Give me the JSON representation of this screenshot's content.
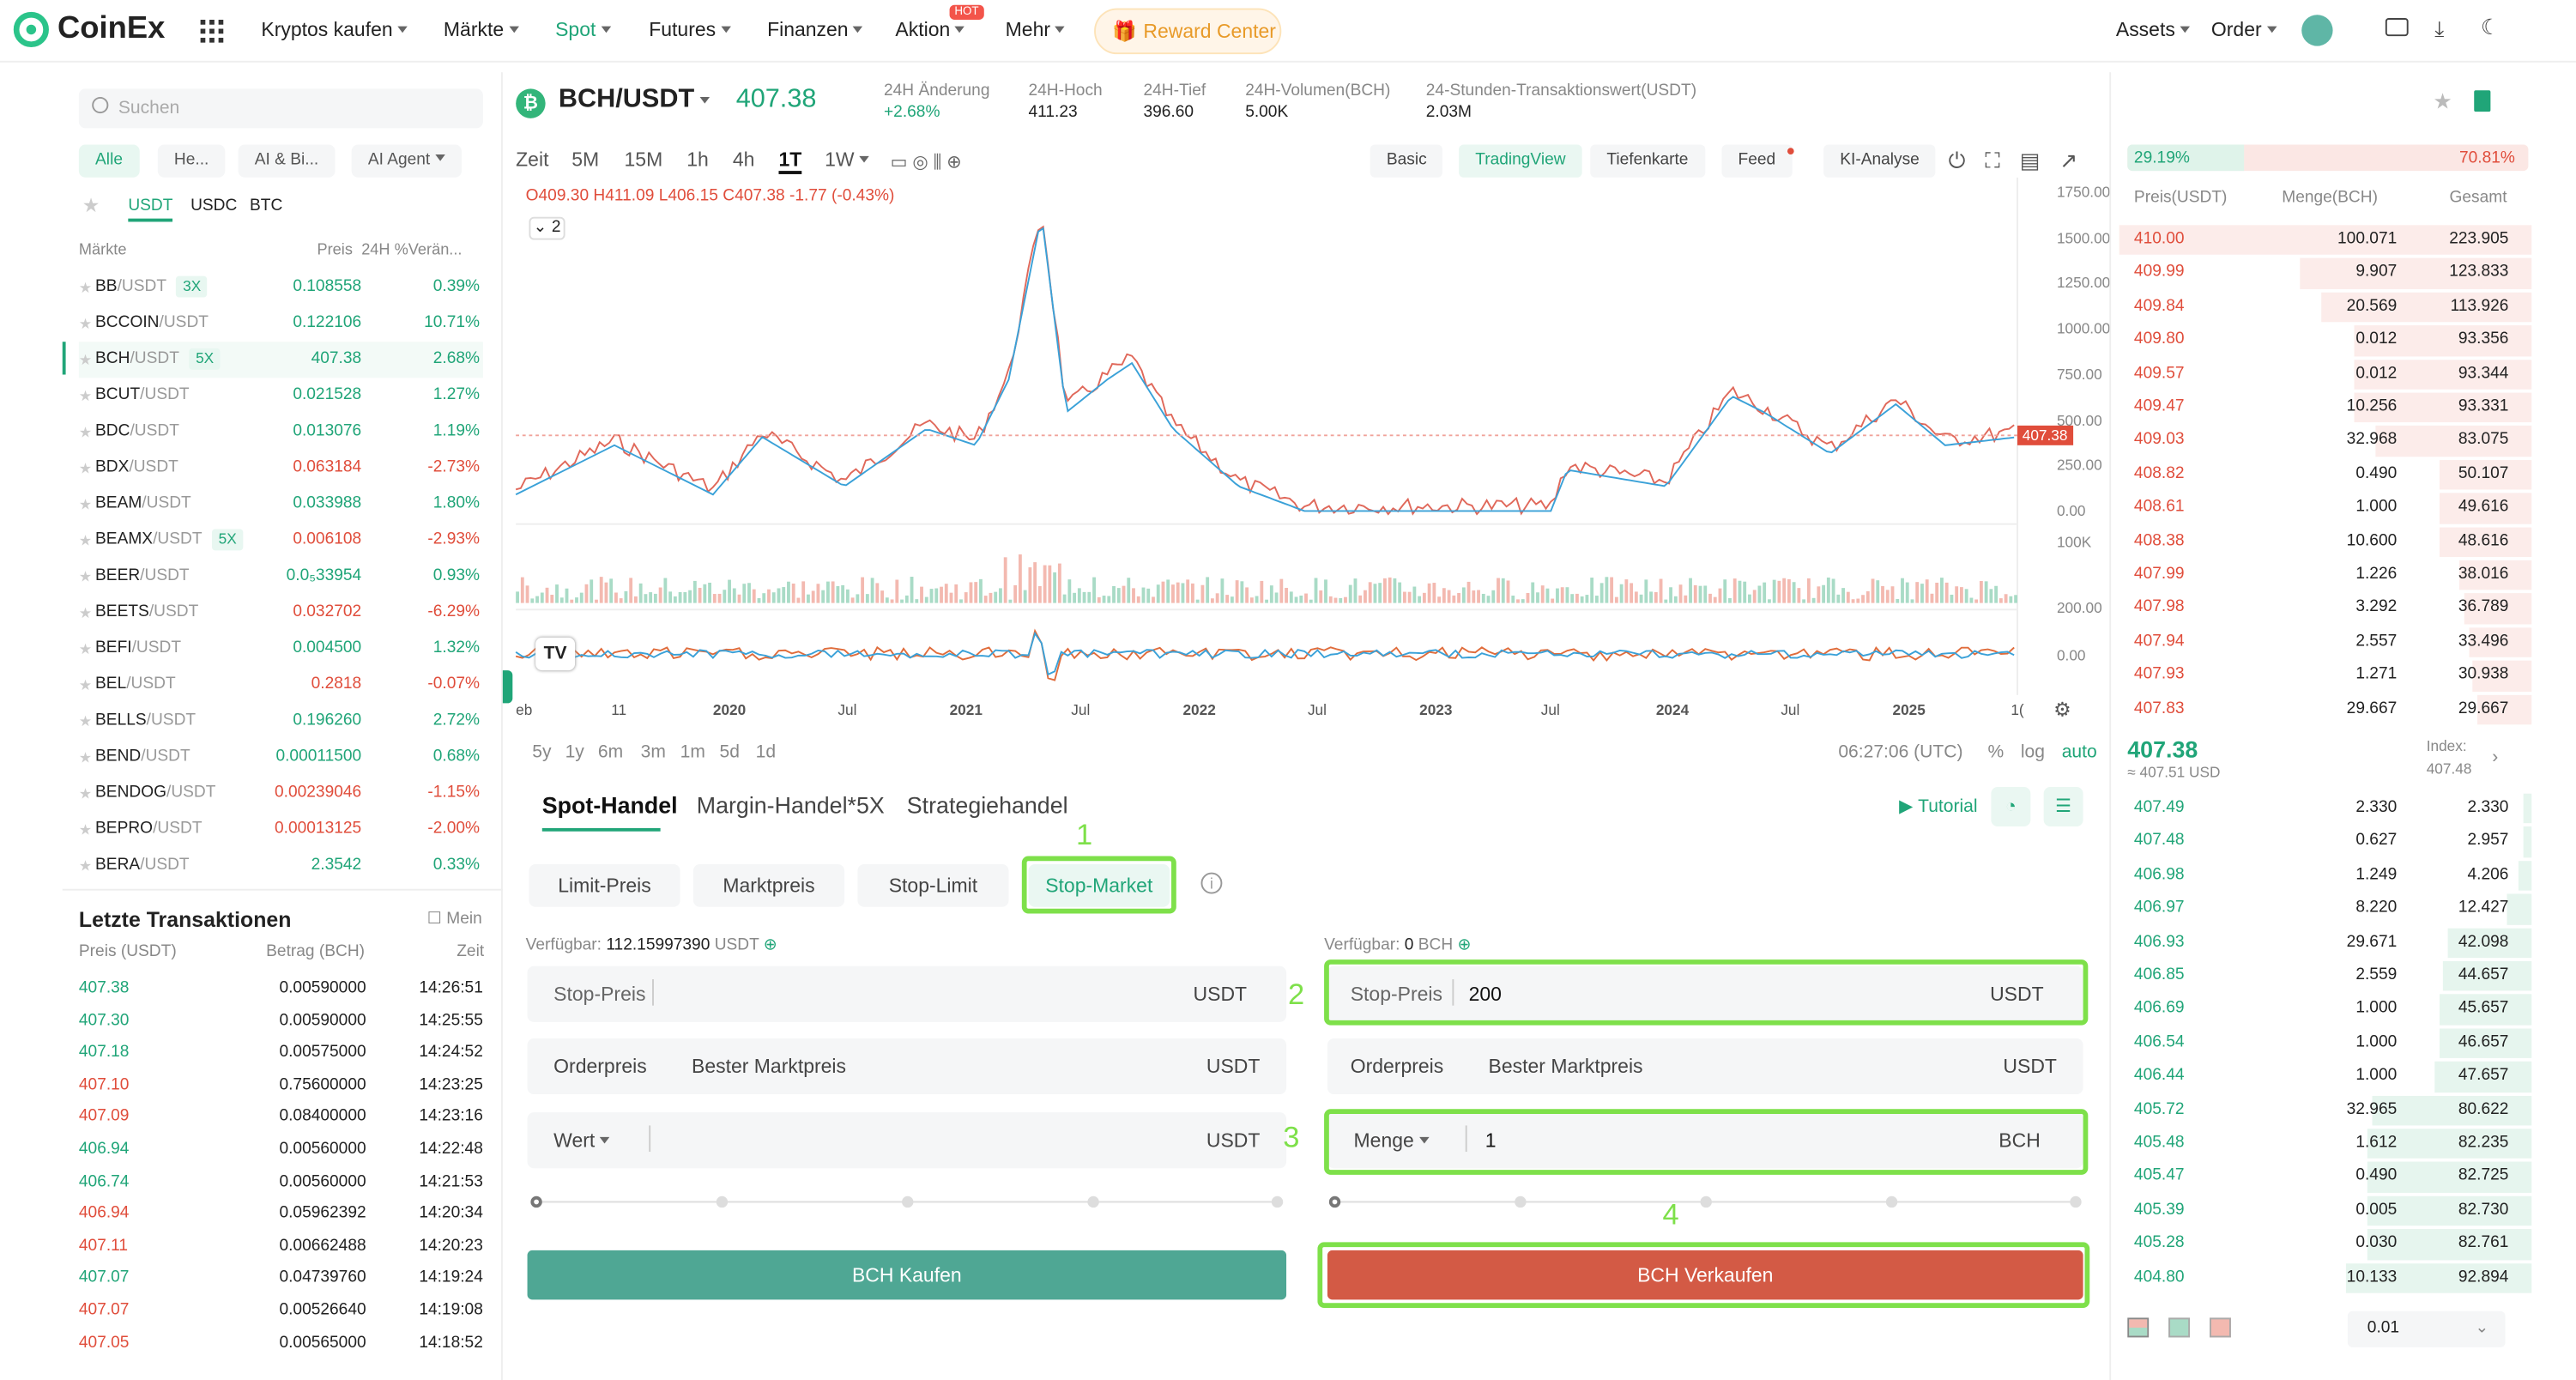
{
  "header": {
    "logo": "CoinEx",
    "nav": [
      {
        "label": "Kryptos kaufen",
        "x": 159
      },
      {
        "label": "Märkte",
        "x": 270
      },
      {
        "label": "Spot",
        "x": 338
      },
      {
        "label": "Futures",
        "x": 395
      },
      {
        "label": "Finanzen",
        "x": 467
      },
      {
        "label": "Aktion",
        "x": 545
      },
      {
        "label": "Mehr",
        "x": 612
      }
    ],
    "hot_badge": "HOT",
    "reward": "Reward Center",
    "assets": "Assets",
    "order": "Order"
  },
  "left": {
    "search_placeholder": "Suchen",
    "chips": [
      "Alle",
      "He...",
      "AI & Bi...",
      "AI Agent"
    ],
    "quotes": [
      "USDT",
      "USDC",
      "BTC"
    ],
    "col_market": "Märkte",
    "col_price": "Preis",
    "col_change": "24H %Verän...",
    "markets": [
      {
        "base": "BB",
        "quote": "/USDT",
        "tag": "3X",
        "price": "0.108558",
        "change": "0.39%",
        "dir": "up"
      },
      {
        "base": "BCCOIN",
        "quote": "/USDT",
        "tag": "",
        "price": "0.122106",
        "change": "10.71%",
        "dir": "up"
      },
      {
        "base": "BCH",
        "quote": "/USDT",
        "tag": "5X",
        "price": "407.38",
        "change": "2.68%",
        "dir": "up"
      },
      {
        "base": "BCUT",
        "quote": "/USDT",
        "tag": "",
        "price": "0.021528",
        "change": "1.27%",
        "dir": "up"
      },
      {
        "base": "BDC",
        "quote": "/USDT",
        "tag": "",
        "price": "0.013076",
        "change": "1.19%",
        "dir": "up"
      },
      {
        "base": "BDX",
        "quote": "/USDT",
        "tag": "",
        "price": "0.063184",
        "change": "-2.73%",
        "dir": "down"
      },
      {
        "base": "BEAM",
        "quote": "/USDT",
        "tag": "",
        "price": "0.033988",
        "change": "1.80%",
        "dir": "up"
      },
      {
        "base": "BEAMX",
        "quote": "/USDT",
        "tag": "5X",
        "price": "0.006108",
        "change": "-2.93%",
        "dir": "down"
      },
      {
        "base": "BEER",
        "quote": "/USDT",
        "tag": "",
        "price": "0.0₅33954",
        "change": "0.93%",
        "dir": "up"
      },
      {
        "base": "BEETS",
        "quote": "/USDT",
        "tag": "",
        "price": "0.032702",
        "change": "-6.29%",
        "dir": "down"
      },
      {
        "base": "BEFI",
        "quote": "/USDT",
        "tag": "",
        "price": "0.004500",
        "change": "1.32%",
        "dir": "up"
      },
      {
        "base": "BEL",
        "quote": "/USDT",
        "tag": "",
        "price": "0.2818",
        "change": "-0.07%",
        "dir": "down"
      },
      {
        "base": "BELLS",
        "quote": "/USDT",
        "tag": "",
        "price": "0.196260",
        "change": "2.72%",
        "dir": "up"
      },
      {
        "base": "BEND",
        "quote": "/USDT",
        "tag": "",
        "price": "0.00011500",
        "change": "0.68%",
        "dir": "up"
      },
      {
        "base": "BENDOG",
        "quote": "/USDT",
        "tag": "",
        "price": "0.00239046",
        "change": "-1.15%",
        "dir": "down"
      },
      {
        "base": "BEPRO",
        "quote": "/USDT",
        "tag": "",
        "price": "0.00013125",
        "change": "-2.00%",
        "dir": "down"
      },
      {
        "base": "BERA",
        "quote": "/USDT",
        "tag": "",
        "price": "2.3542",
        "change": "0.33%",
        "dir": "up"
      }
    ],
    "trades_title": "Letzte Transaktionen",
    "trades_mine": "Mein",
    "trades_cols": [
      "Preis (USDT)",
      "Betrag (BCH)",
      "Zeit"
    ],
    "trades": [
      {
        "price": "407.38",
        "amount": "0.00590000",
        "time": "14:26:51",
        "dir": "up"
      },
      {
        "price": "407.30",
        "amount": "0.00590000",
        "time": "14:25:55",
        "dir": "up"
      },
      {
        "price": "407.18",
        "amount": "0.00575000",
        "time": "14:24:52",
        "dir": "up"
      },
      {
        "price": "407.10",
        "amount": "0.75600000",
        "time": "14:23:25",
        "dir": "down"
      },
      {
        "price": "407.09",
        "amount": "0.08400000",
        "time": "14:23:16",
        "dir": "down"
      },
      {
        "price": "406.94",
        "amount": "0.00560000",
        "time": "14:22:48",
        "dir": "up"
      },
      {
        "price": "406.74",
        "amount": "0.00560000",
        "time": "14:21:53",
        "dir": "up"
      },
      {
        "price": "406.94",
        "amount": "0.05962392",
        "time": "14:20:34",
        "dir": "down"
      },
      {
        "price": "407.11",
        "amount": "0.00662488",
        "time": "14:20:23",
        "dir": "down"
      },
      {
        "price": "407.07",
        "amount": "0.04739760",
        "time": "14:19:24",
        "dir": "up"
      },
      {
        "price": "407.07",
        "amount": "0.00526640",
        "time": "14:19:08",
        "dir": "down"
      },
      {
        "price": "407.05",
        "amount": "0.00565000",
        "time": "14:18:52",
        "dir": "down"
      }
    ]
  },
  "ticker": {
    "pair": "BCH/USDT",
    "price": "407.38",
    "stats": [
      {
        "label": "24H Änderung",
        "value": "+2.68%",
        "green": true
      },
      {
        "label": "24H-Hoch",
        "value": "411.23"
      },
      {
        "label": "24H-Tief",
        "value": "396.60"
      },
      {
        "label": "24H-Volumen(BCH)",
        "value": "5.00K"
      },
      {
        "label": "24-Stunden-Transaktionswert(USDT)",
        "value": "2.03M"
      }
    ]
  },
  "chart": {
    "timeframes": [
      "Zeit",
      "5M",
      "15M",
      "1h",
      "4h",
      "1T",
      "1W"
    ],
    "views": [
      "Basic",
      "TradingView",
      "Tiefenkarte",
      "Feed",
      "KI-Analyse"
    ],
    "ohlc": {
      "o": "O409.30",
      "h": "H411.09",
      "l": "L406.15",
      "c": "C407.38",
      "chg": "-1.77 (-0.43%)"
    },
    "indicator_count": "2",
    "price_ticks": [
      "1750.00",
      "1500.00",
      "1250.00",
      "1000.00",
      "750.00",
      "500.00",
      "250.00",
      "0.00"
    ],
    "current_price_label": "407.38",
    "vol_tick": "100K",
    "osc_ticks": [
      "200.00",
      "0.00"
    ],
    "x_ticks": [
      "eb",
      "11",
      "2020",
      "Jul",
      "2021",
      "Jul",
      "2022",
      "Jul",
      "2023",
      "Jul",
      "2024",
      "Jul",
      "2025",
      "1("
    ],
    "ranges": [
      "5y",
      "1y",
      "6m",
      "3m",
      "1m",
      "5d",
      "1d"
    ],
    "clock": "06:27:06 (UTC)",
    "pct": "%",
    "log": "log",
    "auto": "auto",
    "logo": "TV"
  },
  "trade": {
    "tabs": [
      "Spot-Handel",
      "Margin-Handel*5X",
      "Strategiehandel"
    ],
    "tutorial": "Tutorial",
    "order_types": [
      "Limit-Preis",
      "Marktpreis",
      "Stop-Limit",
      "Stop-Market"
    ],
    "buy": {
      "available_label": "Verfügbar:",
      "available": "112.15997390",
      "available_unit": "USDT",
      "stop_label": "Stop-Preis",
      "stop_value": "",
      "stop_unit": "USDT",
      "order_label": "Orderpreis",
      "order_value": "Bester Marktpreis",
      "order_unit": "USDT",
      "amount_label": "Wert",
      "amount_value": "",
      "amount_unit": "USDT",
      "button": "BCH Kaufen"
    },
    "sell": {
      "available_label": "Verfügbar:",
      "available": "0",
      "available_unit": "BCH",
      "stop_label": "Stop-Preis",
      "stop_value": "200",
      "stop_unit": "USDT",
      "order_label": "Orderpreis",
      "order_value": "Bester Marktpreis",
      "order_unit": "USDT",
      "amount_label": "Menge",
      "amount_value": "1",
      "amount_unit": "BCH",
      "button": "BCH Verkaufen"
    },
    "steps": [
      "1",
      "2",
      "3",
      "4"
    ]
  },
  "book": {
    "buy_ratio": "29.19%",
    "sell_ratio": "70.81%",
    "cols": [
      "Preis(USDT)",
      "Menge(BCH)",
      "Gesamt"
    ],
    "asks": [
      {
        "p": "410.00",
        "q": "100.071",
        "t": "223.905",
        "depth": 0.98
      },
      {
        "p": "409.99",
        "q": "9.907",
        "t": "123.833",
        "depth": 0.55
      },
      {
        "p": "409.84",
        "q": "20.569",
        "t": "113.926",
        "depth": 0.5
      },
      {
        "p": "409.80",
        "q": "0.012",
        "t": "93.356",
        "depth": 0.42
      },
      {
        "p": "409.57",
        "q": "0.012",
        "t": "93.344",
        "depth": 0.42
      },
      {
        "p": "409.47",
        "q": "10.256",
        "t": "93.331",
        "depth": 0.42
      },
      {
        "p": "409.03",
        "q": "32.968",
        "t": "83.075",
        "depth": 0.37
      },
      {
        "p": "408.82",
        "q": "0.490",
        "t": "50.107",
        "depth": 0.22
      },
      {
        "p": "408.61",
        "q": "1.000",
        "t": "49.616",
        "depth": 0.22
      },
      {
        "p": "408.38",
        "q": "10.600",
        "t": "48.616",
        "depth": 0.22
      },
      {
        "p": "407.99",
        "q": "1.226",
        "t": "38.016",
        "depth": 0.17
      },
      {
        "p": "407.98",
        "q": "3.292",
        "t": "36.789",
        "depth": 0.16
      },
      {
        "p": "407.94",
        "q": "2.557",
        "t": "33.496",
        "depth": 0.15
      },
      {
        "p": "407.93",
        "q": "1.271",
        "t": "30.938",
        "depth": 0.14
      },
      {
        "p": "407.83",
        "q": "29.667",
        "t": "29.667",
        "depth": 0.13
      }
    ],
    "mid_price": "407.38",
    "mid_usd": "≈ 407.51 USD",
    "index_label": "Index:",
    "index_value": "407.48",
    "bids": [
      {
        "p": "407.49",
        "q": "2.330",
        "t": "2.330",
        "depth": 0.02
      },
      {
        "p": "407.48",
        "q": "0.627",
        "t": "2.957",
        "depth": 0.02
      },
      {
        "p": "406.98",
        "q": "1.249",
        "t": "4.206",
        "depth": 0.03
      },
      {
        "p": "406.97",
        "q": "8.220",
        "t": "12.427",
        "depth": 0.06
      },
      {
        "p": "406.93",
        "q": "29.671",
        "t": "42.098",
        "depth": 0.2
      },
      {
        "p": "406.85",
        "q": "2.559",
        "t": "44.657",
        "depth": 0.21
      },
      {
        "p": "406.69",
        "q": "1.000",
        "t": "45.657",
        "depth": 0.22
      },
      {
        "p": "406.54",
        "q": "1.000",
        "t": "46.657",
        "depth": 0.22
      },
      {
        "p": "406.44",
        "q": "1.000",
        "t": "47.657",
        "depth": 0.23
      },
      {
        "p": "405.72",
        "q": "32.965",
        "t": "80.622",
        "depth": 0.38
      },
      {
        "p": "405.48",
        "q": "1.612",
        "t": "82.235",
        "depth": 0.39
      },
      {
        "p": "405.47",
        "q": "0.490",
        "t": "82.725",
        "depth": 0.39
      },
      {
        "p": "405.39",
        "q": "0.005",
        "t": "82.730",
        "depth": 0.39
      },
      {
        "p": "405.28",
        "q": "0.030",
        "t": "82.761",
        "depth": 0.39
      },
      {
        "p": "404.80",
        "q": "10.133",
        "t": "92.894",
        "depth": 0.44
      }
    ],
    "precision": "0.01"
  },
  "colors": {
    "green": "#20a578",
    "red": "#e04d3b",
    "highlight": "#7ee04a"
  }
}
